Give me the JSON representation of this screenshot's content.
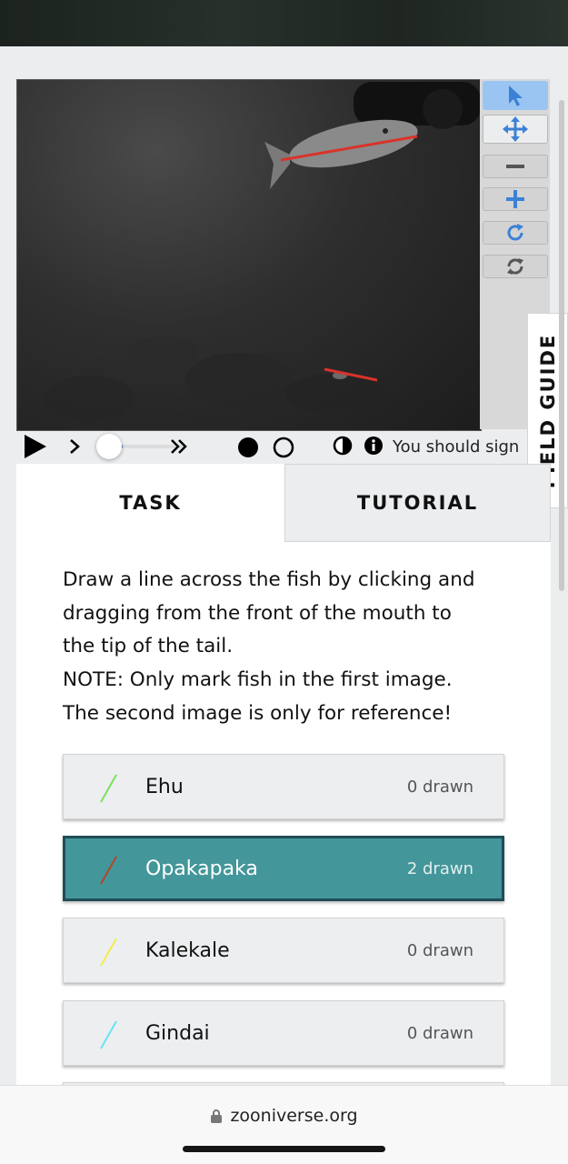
{
  "app": {
    "url": "zooniverse.org",
    "field_guide_label": "FIELD GUIDE",
    "signin_notice": "You should sign"
  },
  "viewer": {
    "tools": [
      {
        "name": "pointer-icon",
        "active": true
      },
      {
        "name": "move-icon",
        "active": false
      },
      {
        "name": "zoom-out-icon",
        "active": false
      },
      {
        "name": "zoom-in-icon",
        "active": false
      },
      {
        "name": "rotate-icon",
        "active": false
      },
      {
        "name": "reset-icon",
        "active": false
      }
    ]
  },
  "tabs": {
    "task_label": "TASK",
    "tutorial_label": "TUTORIAL"
  },
  "task": {
    "instructions": [
      "Draw a line across the fish by clicking and",
      "dragging from the front of the mouth to",
      "the tip of the tail.",
      "NOTE: Only mark fish in the first image.",
      "The second image is only for reference!"
    ],
    "choices": [
      {
        "label": "Ehu",
        "count": "0 drawn",
        "color": "#7be05a",
        "selected": false
      },
      {
        "label": "Opakapaka",
        "count": "2 drawn",
        "color": "#b3472b",
        "selected": true
      },
      {
        "label": "Kalekale",
        "count": "0 drawn",
        "color": "#f3ec4a",
        "selected": false
      },
      {
        "label": "Gindai",
        "count": "0 drawn",
        "color": "#66e4f2",
        "selected": false
      }
    ]
  },
  "colors": {
    "accent": "#43969a",
    "tool_active": "#9ac5f2",
    "icon_blue": "#3b82d6"
  }
}
